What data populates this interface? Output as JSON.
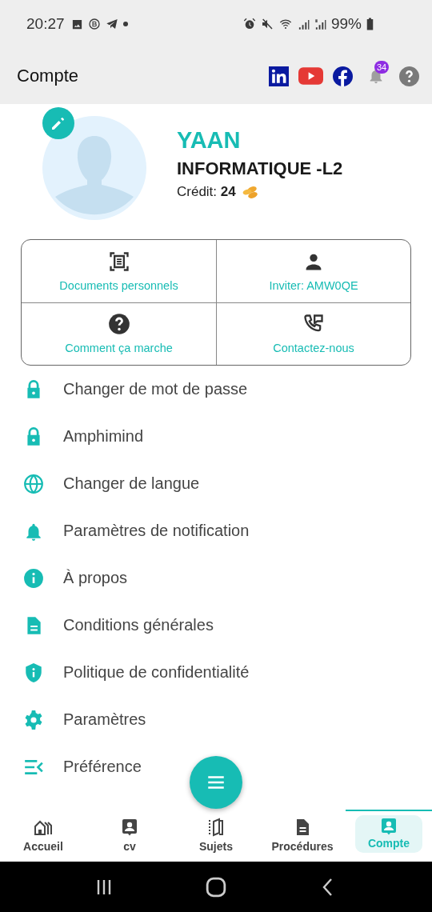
{
  "status_bar": {
    "time": "20:27",
    "battery": "99%"
  },
  "app_bar": {
    "title": "Compte",
    "notification_count": "34"
  },
  "profile": {
    "name": "YAAN",
    "program": "INFORMATIQUE -L2",
    "credit": "Crédit: **24**"
  },
  "shortcuts": [
    {
      "label": "Documents personnels"
    },
    {
      "label": "Inviter: AMW0QE"
    },
    {
      "label": "Comment ça marche"
    },
    {
      "label": "Contactez-nous"
    }
  ],
  "menu": [
    {
      "label": "Changer de mot de passe"
    },
    {
      "label": "Amphimind"
    },
    {
      "label": "Changer de langue"
    },
    {
      "label": "Paramètres de notification"
    },
    {
      "label": "À propos"
    },
    {
      "label": "Conditions générales"
    },
    {
      "label": "Politique de confidentialité"
    },
    {
      "label": "Paramètres"
    },
    {
      "label": "Préférence"
    }
  ],
  "bottom_nav": [
    {
      "label": "Accueil",
      "selected": false
    },
    {
      "label": "cv",
      "selected": false
    },
    {
      "label": "Sujets",
      "selected": false
    },
    {
      "label": "Procédures",
      "selected": false
    },
    {
      "label": "Compte",
      "selected": true
    }
  ]
}
